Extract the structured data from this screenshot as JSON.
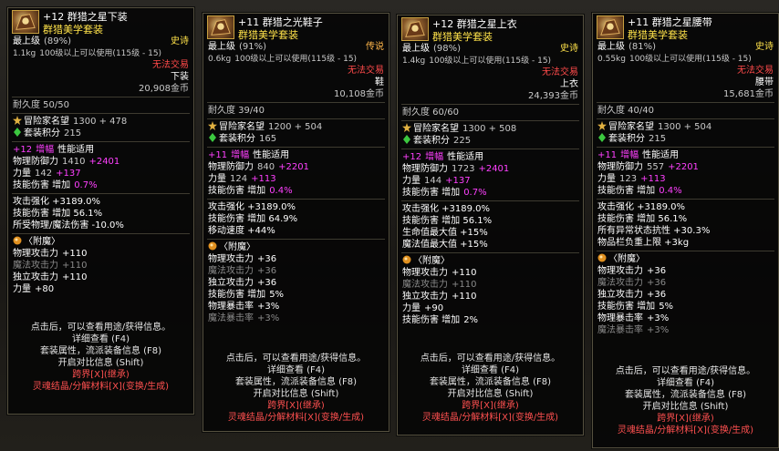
{
  "panels": [
    {
      "title": "+12 群猎之星下装",
      "set": "群猎美学套装",
      "grade": "最上级",
      "grade_pct": "(89%)",
      "rarity": "史诗",
      "weight": "1.1kg",
      "req": "100级以上可以使用(115级 - 15)",
      "trade": "无法交易",
      "slot": "下装",
      "price": "20,908金币",
      "durability": "耐久度 50/50",
      "fame_label": "冒险家名望",
      "fame_value": "1300 + 478",
      "setpoint_label": "套装积分",
      "setpoint_value": "215",
      "amp": "+12",
      "amp_label": "增幅",
      "amp_note": "性能适用",
      "stats": [
        {
          "label": "物理防御力",
          "base": "1410",
          "bonus": "+2401"
        },
        {
          "label": "力量",
          "base": "142",
          "bonus": "+137"
        },
        {
          "label": "技能伤害 增加",
          "base": "",
          "bonus": "0.7%"
        }
      ],
      "effects": [
        "攻击强化 +3189.0%",
        "技能伤害 增加 56.1%",
        "所受物理/魔法伤害 -10.0%"
      ],
      "enchant_title": "〈附魔〉",
      "enchants": [
        {
          "label": "物理攻击力",
          "value": "+110",
          "dim": false
        },
        {
          "label": "魔法攻击力",
          "value": "+110",
          "dim": true
        },
        {
          "label": "独立攻击力",
          "value": "+110",
          "dim": false
        },
        {
          "label": "力量",
          "value": "+80",
          "dim": false
        }
      ]
    },
    {
      "title": "+11 群猎之光鞋子",
      "set": "群猎美学套装",
      "grade": "最上级",
      "grade_pct": "(91%)",
      "rarity": "传说",
      "weight": "0.6kg",
      "req": "100级以上可以使用(115级 - 15)",
      "trade": "无法交易",
      "slot": "鞋",
      "price": "10,108金币",
      "durability": "耐久度 39/40",
      "fame_label": "冒险家名望",
      "fame_value": "1200 + 504",
      "setpoint_label": "套装积分",
      "setpoint_value": "165",
      "amp": "+11",
      "amp_label": "增幅",
      "amp_note": "性能适用",
      "stats": [
        {
          "label": "物理防御力",
          "base": "840",
          "bonus": "+2201"
        },
        {
          "label": "力量",
          "base": "124",
          "bonus": "+113"
        },
        {
          "label": "技能伤害 增加",
          "base": "",
          "bonus": "0.4%"
        }
      ],
      "effects": [
        "攻击强化 +3189.0%",
        "技能伤害 增加 64.9%",
        "移动速度 +44%"
      ],
      "enchant_title": "〈附魔〉",
      "enchants": [
        {
          "label": "物理攻击力",
          "value": "+36",
          "dim": false
        },
        {
          "label": "魔法攻击力",
          "value": "+36",
          "dim": true
        },
        {
          "label": "独立攻击力",
          "value": "+36",
          "dim": false
        },
        {
          "label": "技能伤害 增加",
          "value": "5%",
          "dim": false
        },
        {
          "label": "物理暴击率",
          "value": "+3%",
          "dim": false
        },
        {
          "label": "魔法暴击率",
          "value": "+3%",
          "dim": true
        }
      ]
    },
    {
      "title": "+12 群猎之星上衣",
      "set": "群猎美学套装",
      "grade": "最上级",
      "grade_pct": "(98%)",
      "rarity": "史诗",
      "weight": "1.4kg",
      "req": "100级以上可以使用(115级 - 15)",
      "trade": "无法交易",
      "slot": "上衣",
      "price": "24,393金币",
      "durability": "耐久度 60/60",
      "fame_label": "冒险家名望",
      "fame_value": "1300 + 508",
      "setpoint_label": "套装积分",
      "setpoint_value": "225",
      "amp": "+12",
      "amp_label": "增幅",
      "amp_note": "性能适用",
      "stats": [
        {
          "label": "物理防御力",
          "base": "1723",
          "bonus": "+2401"
        },
        {
          "label": "力量",
          "base": "144",
          "bonus": "+137"
        },
        {
          "label": "技能伤害 增加",
          "base": "",
          "bonus": "0.7%"
        }
      ],
      "effects": [
        "攻击强化 +3189.0%",
        "技能伤害 增加 56.1%",
        "生命值最大值 +15%",
        "魔法值最大值 +15%"
      ],
      "enchant_title": "〈附魔〉",
      "enchants": [
        {
          "label": "物理攻击力",
          "value": "+110",
          "dim": false
        },
        {
          "label": "魔法攻击力",
          "value": "+110",
          "dim": true
        },
        {
          "label": "独立攻击力",
          "value": "+110",
          "dim": false
        },
        {
          "label": "力量",
          "value": "+90",
          "dim": false
        },
        {
          "label": "技能伤害 增加",
          "value": "2%",
          "dim": false
        }
      ]
    },
    {
      "title": "+11 群猎之星腰带",
      "set": "群猎美学套装",
      "grade": "最上级",
      "grade_pct": "(81%)",
      "rarity": "史诗",
      "weight": "0.55kg",
      "req": "100级以上可以使用(115级 - 15)",
      "trade": "无法交易",
      "slot": "腰带",
      "price": "15,681金币",
      "durability": "耐久度 40/40",
      "fame_label": "冒险家名望",
      "fame_value": "1300 + 504",
      "setpoint_label": "套装积分",
      "setpoint_value": "215",
      "amp": "+11",
      "amp_label": "增幅",
      "amp_note": "性能适用",
      "stats": [
        {
          "label": "物理防御力",
          "base": "557",
          "bonus": "+2201"
        },
        {
          "label": "力量",
          "base": "123",
          "bonus": "+113"
        },
        {
          "label": "技能伤害 增加",
          "base": "",
          "bonus": "0.4%"
        }
      ],
      "effects": [
        "攻击强化 +3189.0%",
        "技能伤害 增加 56.1%",
        "所有异常状态抗性 +30.3%",
        "物品栏负重上限 +3kg"
      ],
      "enchant_title": "〈附魔〉",
      "enchants": [
        {
          "label": "物理攻击力",
          "value": "+36",
          "dim": false
        },
        {
          "label": "魔法攻击力",
          "value": "+36",
          "dim": true
        },
        {
          "label": "独立攻击力",
          "value": "+36",
          "dim": false
        },
        {
          "label": "技能伤害 增加",
          "value": "5%",
          "dim": false
        },
        {
          "label": "物理暴击率",
          "value": "+3%",
          "dim": false
        },
        {
          "label": "魔法暴击率",
          "value": "+3%",
          "dim": true
        }
      ]
    }
  ],
  "hints": {
    "click_info": "点击后，可以查看用途/获得信息。",
    "detail": "详细查看 (F4)",
    "set_attr": "套装属性，流派装备信息 (F8)",
    "compare": "开启对比信息 (Shift)",
    "cross": "跨界[X](继承)",
    "soul": "灵魂结晶/分解材料[X](变换/生成)"
  }
}
